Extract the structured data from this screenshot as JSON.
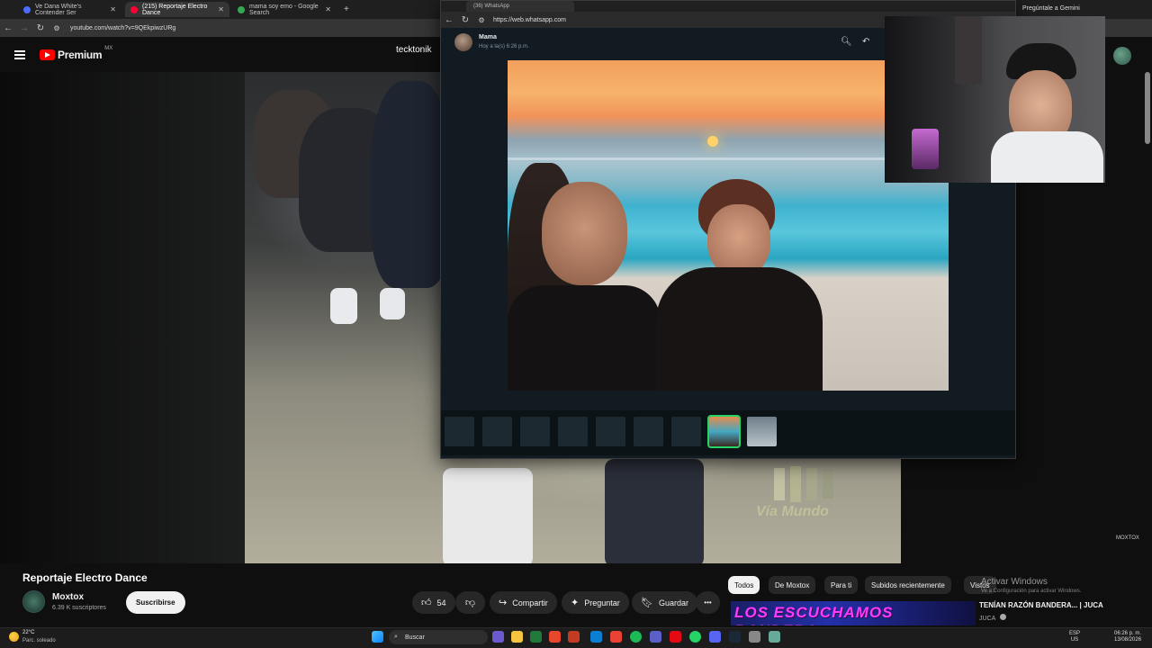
{
  "browser": {
    "tabs": [
      {
        "title": "Ve Dana White's Contender Ser"
      },
      {
        "title": "(215) Reportaje Electro Dance"
      },
      {
        "title": "mama soy emo - Google Search"
      }
    ],
    "new_tab": "+",
    "url": "youtube.com/watch?v=9QEkpiwzURg"
  },
  "youtube": {
    "logo_word": "Premium",
    "region": "MX",
    "search_text": "tecktonik",
    "video_title": "Reportaje Electro Dance",
    "channel_name": "Moxtox",
    "subscribers": "6.39 K suscriptores",
    "subscribe_label": "Suscribirse",
    "likes": "54",
    "share_label": "Compartir",
    "ask_label": "Preguntar",
    "save_label": "Guardar",
    "more_label": "•••",
    "chips": [
      "Todos",
      "De Moxtox",
      "Para ti",
      "Subidos recientemente",
      "Vistos"
    ],
    "watermark": "Vía Mundo",
    "corner_tag": "MOXTOX",
    "recommended": {
      "thumb_text": "LOS ESCUCHAMOS BANDERA",
      "title": "TENÍAN RAZÓN BANDERA... | JUCA",
      "channel": "JUCA"
    }
  },
  "windows_activation": {
    "title": "Activar Windows",
    "subtitle": "Ve a Configuración para activar Windows."
  },
  "gemini_button": "Pregúntale a Gemini",
  "whatsapp": {
    "tab_title": "(36) WhatsApp",
    "url": "https://web.whatsapp.com",
    "contact": "Mama",
    "timestamp": "Hoy a la(s) 6:26 p.m."
  },
  "taskbar": {
    "temperature": "22°C",
    "weather": "Parc. soleado",
    "search_label": "Buscar",
    "lang_1": "ESP",
    "lang_2": "US",
    "time": "06:26 p. m.",
    "date": "13/08/2026"
  },
  "colors": {
    "youtube_red": "#ff0000",
    "whatsapp_green": "#25d366",
    "background": "#0f0f0f"
  }
}
